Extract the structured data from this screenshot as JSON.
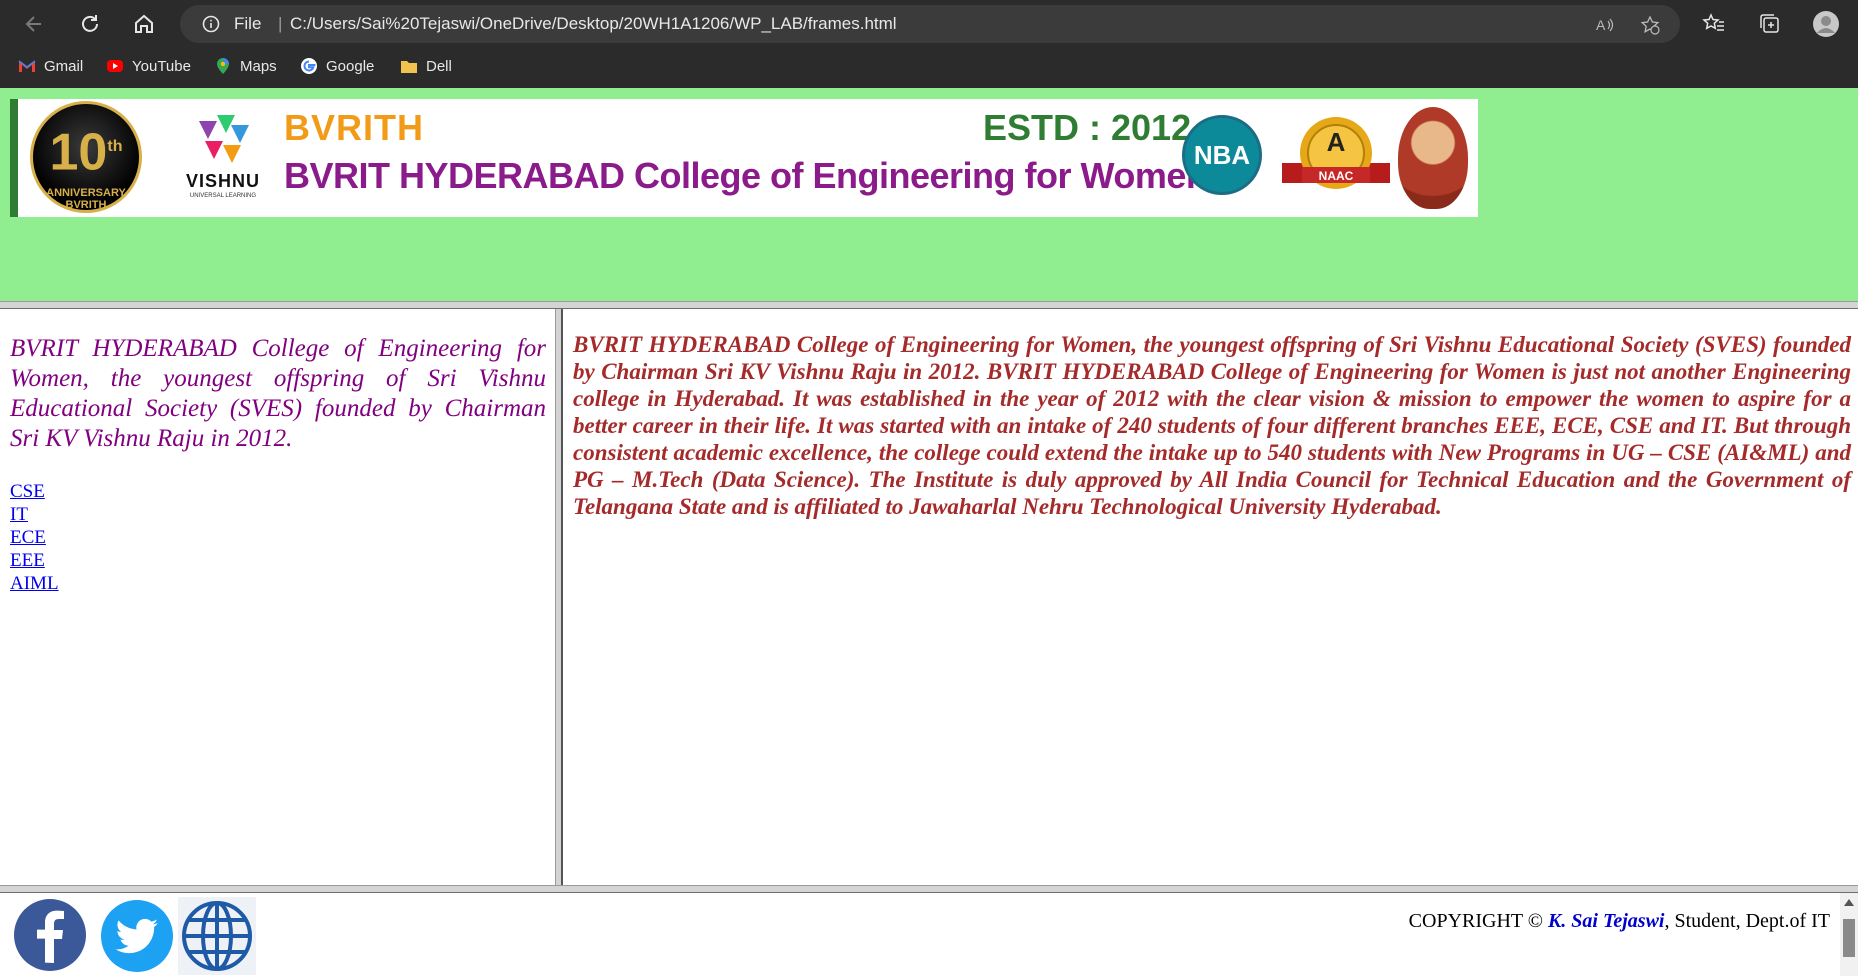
{
  "browser": {
    "file_label": "File",
    "url": "C:/Users/Sai%20Tejaswi/OneDrive/Desktop/20WH1A1206/WP_LAB/frames.html",
    "bookmarks": [
      {
        "label": "Gmail",
        "icon": "gmail-icon"
      },
      {
        "label": "YouTube",
        "icon": "youtube-icon"
      },
      {
        "label": "Maps",
        "icon": "maps-icon"
      },
      {
        "label": "Google",
        "icon": "google-icon"
      },
      {
        "label": "Dell",
        "icon": "folder-icon"
      }
    ]
  },
  "header": {
    "anniversary_number": "10",
    "anniversary_sup": "th",
    "anniversary_text": "ANNIVERSARY",
    "anniversary_brand": "BVRITH",
    "vishnu_name": "VISHNU",
    "vishnu_sub": "UNIVERSAL LEARNING",
    "short_name": "BVRITH",
    "estd": "ESTD : 2012",
    "college_name": "BVRIT HYDERABAD College of Engineering for Women",
    "nba_label": "NBA",
    "naac_grade": "A",
    "naac_label": "NAAC",
    "background_color": "#90ee90"
  },
  "left": {
    "intro": "BVRIT HYDERABAD College of Engineering for Women, the youngest offspring of Sri Vishnu Educational Society (SVES) founded by Chairman Sri KV Vishnu Raju in 2012.",
    "links": [
      "CSE",
      "IT",
      "ECE",
      "EEE",
      "AIML"
    ]
  },
  "main": {
    "description": "BVRIT HYDERABAD College of Engineering for Women, the youngest offspring of Sri Vishnu Educational Society (SVES) founded by Chairman Sri KV Vishnu Raju in 2012. BVRIT HYDERABAD College of Engineering for Women is just not another Engineering college in Hyderabad. It was established in the year of 2012 with the clear vision & mission to empower the women to aspire for a better career in their life. It was started with an intake of 240 students of four different branches EEE, ECE, CSE and IT. But through consistent academic excellence, the college could extend the intake up to 540 students with New Programs in UG – CSE (AI&ML) and PG – M.Tech (Data Science). The Institute is duly approved by All India Council for Technical Education and the Government of Telangana State and is affiliated to Jawaharlal Nehru Technological University Hyderabad."
  },
  "footer": {
    "copyright_prefix": "COPYRIGHT © ",
    "author": "K. Sai Tejaswi",
    "copyright_suffix": ", Student, Dept.of IT",
    "social_icons": [
      "facebook-icon",
      "twitter-icon",
      "globe-icon"
    ]
  }
}
